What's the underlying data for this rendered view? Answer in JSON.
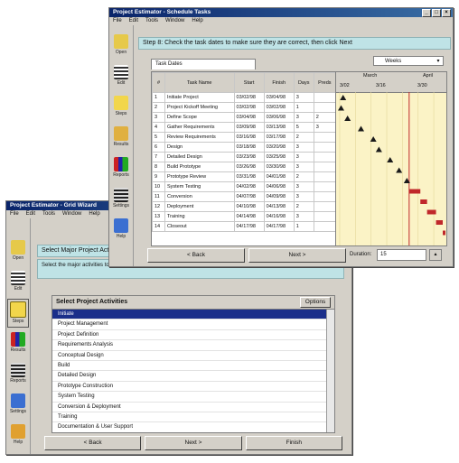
{
  "back_window": {
    "title": "Project Estimator - Grid Wizard",
    "menu": [
      "File",
      "Edit",
      "Tools",
      "Window",
      "Help"
    ],
    "tools": [
      {
        "label": "Open",
        "icon": "open-folder-icon"
      },
      {
        "label": "Edit",
        "icon": "pencil-icon"
      },
      {
        "label": "Steps",
        "icon": "steps-icon"
      },
      {
        "label": "Results",
        "icon": "bar-chart-icon"
      },
      {
        "label": "Reports",
        "icon": "report-icon"
      },
      {
        "label": "Settings",
        "icon": "gear-icon"
      },
      {
        "label": "Help",
        "icon": "help-icon"
      }
    ],
    "header": "Select Major Project Activities",
    "instruction": "Select the major activities to include in your project. Click on an activity to add or remove it from the schedule.",
    "list_title": "Select Project Activities",
    "list_button": "Options",
    "activities": [
      "Initiate",
      "Project Management",
      "Project Definition",
      "Requirements Analysis",
      "Conceptual Design",
      "Build",
      "Detailed Design",
      "Prototype Construction",
      "System Testing",
      "Conversion & Deployment",
      "Training",
      "Documentation & User Support",
      "Closeout"
    ],
    "selected_index": 0,
    "buttons": [
      "< Back",
      "Next >",
      "Finish"
    ]
  },
  "front_window": {
    "title": "Project Estimator - Schedule Tasks",
    "menu": [
      "File",
      "Edit",
      "Tools",
      "Window",
      "Help"
    ],
    "tools": [
      {
        "label": "Open",
        "icon": "open-folder-icon"
      },
      {
        "label": "Edit",
        "icon": "pencil-icon"
      },
      {
        "label": "Steps",
        "icon": "steps-icon"
      },
      {
        "label": "Results",
        "icon": "bar-chart-icon"
      },
      {
        "label": "Reports",
        "icon": "report-icon"
      },
      {
        "label": "Settings",
        "icon": "gear-icon"
      },
      {
        "label": "Help",
        "icon": "help-icon"
      }
    ],
    "header": "Step 8: Check the task dates to make sure they are correct, then click Next",
    "tab_label": "Task Dates",
    "zoom_label": "Weeks",
    "columns": [
      "#",
      "Task Name",
      "Start",
      "Finish",
      "Days",
      "Preds"
    ],
    "gantt_header_top": [
      "March",
      "April"
    ],
    "gantt_header_bottom": [
      "3/02",
      "3/16",
      "3/30"
    ],
    "rows": [
      {
        "n": "1",
        "name": "Initiate Project",
        "start": "03/02/98",
        "finish": "03/04/98",
        "days": "3",
        "pred": ""
      },
      {
        "n": "2",
        "name": "Project Kickoff Meeting",
        "start": "03/02/98",
        "finish": "03/02/98",
        "days": "1",
        "pred": ""
      },
      {
        "n": "3",
        "name": "Define Scope",
        "start": "03/04/98",
        "finish": "03/06/98",
        "days": "3",
        "pred": "2"
      },
      {
        "n": "4",
        "name": "Gather Requirements",
        "start": "03/09/98",
        "finish": "03/13/98",
        "days": "5",
        "pred": "3"
      },
      {
        "n": "5",
        "name": "Review Requirements",
        "start": "03/16/98",
        "finish": "03/17/98",
        "days": "2",
        "pred": ""
      },
      {
        "n": "6",
        "name": "Design",
        "start": "03/18/98",
        "finish": "03/20/98",
        "days": "3",
        "pred": ""
      },
      {
        "n": "7",
        "name": "Detailed Design",
        "start": "03/23/98",
        "finish": "03/25/98",
        "days": "3",
        "pred": ""
      },
      {
        "n": "8",
        "name": "Build Prototype",
        "start": "03/26/98",
        "finish": "03/30/98",
        "days": "3",
        "pred": ""
      },
      {
        "n": "9",
        "name": "Prototype Review",
        "start": "03/31/98",
        "finish": "04/01/98",
        "days": "2",
        "pred": ""
      },
      {
        "n": "10",
        "name": "System Testing",
        "start": "04/02/98",
        "finish": "04/06/98",
        "days": "3",
        "pred": ""
      },
      {
        "n": "11",
        "name": "Conversion",
        "start": "04/07/98",
        "finish": "04/09/98",
        "days": "3",
        "pred": ""
      },
      {
        "n": "12",
        "name": "Deployment",
        "start": "04/10/98",
        "finish": "04/13/98",
        "days": "2",
        "pred": ""
      },
      {
        "n": "13",
        "name": "Training",
        "start": "04/14/98",
        "finish": "04/16/98",
        "days": "3",
        "pred": ""
      },
      {
        "n": "14",
        "name": "Closeout",
        "start": "04/17/98",
        "finish": "04/17/98",
        "days": "1",
        "pred": ""
      }
    ],
    "buttons": [
      "< Back",
      "Next >"
    ],
    "duration_label": "Duration:",
    "duration_value": "15"
  }
}
